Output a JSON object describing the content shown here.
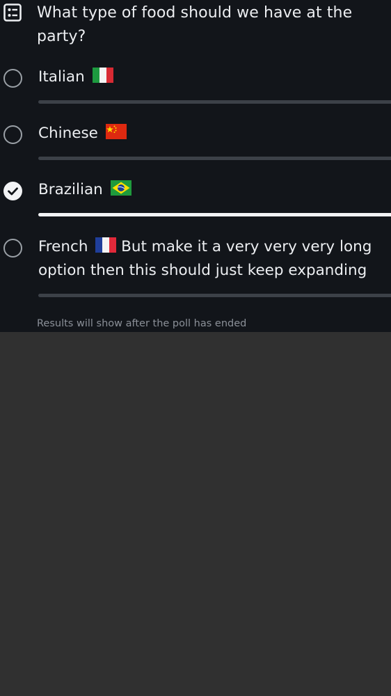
{
  "poll": {
    "icon": "poll-list-icon",
    "question": "What type of food should we have at the party?",
    "options": [
      {
        "label": "Italian",
        "flag": "italy-flag-icon",
        "selected": false
      },
      {
        "label": "Chinese",
        "flag": "china-flag-icon",
        "selected": false
      },
      {
        "label": "Brazilian",
        "flag": "brazil-flag-icon",
        "selected": true
      },
      {
        "label": "French",
        "flag": "france-flag-icon",
        "selected": false,
        "line1_suffix": "But make it a very very very long",
        "line2": "option then this should just keep expanding"
      }
    ],
    "results_note": "Results will show after the poll has ended"
  },
  "colors": {
    "card_bg": "#12151a",
    "page_bg": "#303030",
    "text": "#eceef1",
    "muted": "#8b9098",
    "bar_track": "#3c4148",
    "bar_selected": "#f2f3f5",
    "radio_border": "#9aa0a6"
  }
}
